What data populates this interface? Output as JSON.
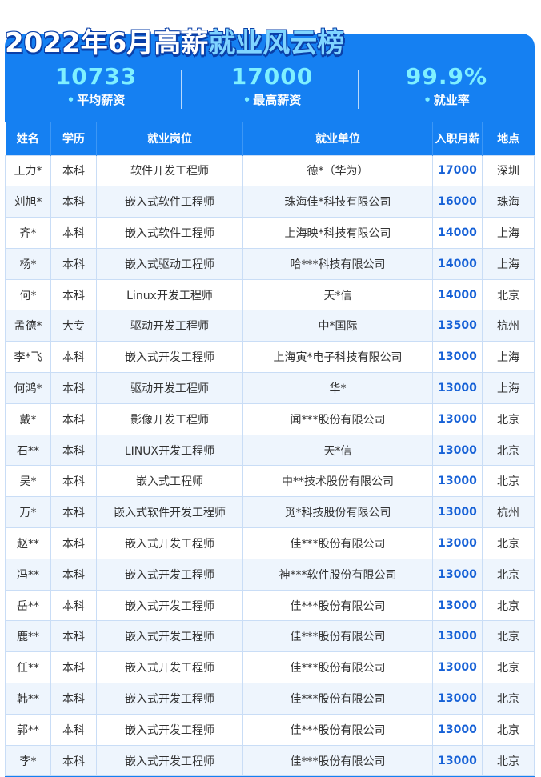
{
  "title": {
    "part1": "2022年6月高薪",
    "part2": "就业风云榜"
  },
  "stats": [
    {
      "value": "10733",
      "dot": "•",
      "label": "平均薪资"
    },
    {
      "value": "17000",
      "dot": "•",
      "label": "最高薪资"
    },
    {
      "value": "99.9%",
      "dot": "•",
      "label": "就业率"
    }
  ],
  "table": {
    "headers": [
      "姓名",
      "学历",
      "就业岗位",
      "就业单位",
      "入职月薪",
      "地点"
    ],
    "rows": [
      [
        "王力*",
        "本科",
        "软件开发工程师",
        "德*（华为）",
        "17000",
        "深圳"
      ],
      [
        "刘旭*",
        "本科",
        "嵌入式软件工程师",
        "珠海佳*科技有限公司",
        "16000",
        "珠海"
      ],
      [
        "齐*",
        "本科",
        "嵌入式软件工程师",
        "上海映*科技有限公司",
        "14000",
        "上海"
      ],
      [
        "杨*",
        "本科",
        "嵌入式驱动工程师",
        "哈***科技有限公司",
        "14000",
        "上海"
      ],
      [
        "何*",
        "本科",
        "Linux开发工程师",
        "天*信",
        "14000",
        "北京"
      ],
      [
        "孟德*",
        "大专",
        "驱动开发工程师",
        "中*国际",
        "13500",
        "杭州"
      ],
      [
        "李*飞",
        "本科",
        "嵌入式开发工程师",
        "上海寅*电子科技有限公司",
        "13000",
        "上海"
      ],
      [
        "何鸿*",
        "本科",
        "驱动开发工程师",
        "华*",
        "13000",
        "上海"
      ],
      [
        "戴*",
        "本科",
        "影像开发工程师",
        "闻***股份有限公司",
        "13000",
        "北京"
      ],
      [
        "石**",
        "本科",
        "LINUX开发工程师",
        "天*信",
        "13000",
        "北京"
      ],
      [
        "吴*",
        "本科",
        "嵌入式工程师",
        "中**技术股份有限公司",
        "13000",
        "北京"
      ],
      [
        "万*",
        "本科",
        "嵌入式软件开发工程师",
        "觅*科技股份有限公司",
        "13000",
        "杭州"
      ],
      [
        "赵**",
        "本科",
        "嵌入式开发工程师",
        "佳***股份有限公司",
        "13000",
        "北京"
      ],
      [
        "冯**",
        "本科",
        "嵌入式开发工程师",
        "神***软件股份有限公司",
        "13000",
        "北京"
      ],
      [
        "岳**",
        "本科",
        "嵌入式开发工程师",
        "佳***股份有限公司",
        "13000",
        "北京"
      ],
      [
        "鹿**",
        "本科",
        "嵌入式开发工程师",
        "佳***股份有限公司",
        "13000",
        "北京"
      ],
      [
        "任**",
        "本科",
        "嵌入式开发工程师",
        "佳***股份有限公司",
        "13000",
        "北京"
      ],
      [
        "韩**",
        "本科",
        "嵌入式开发工程师",
        "佳***股份有限公司",
        "13000",
        "北京"
      ],
      [
        "郭**",
        "本科",
        "嵌入式开发工程师",
        "佳***股份有限公司",
        "13000",
        "北京"
      ],
      [
        "李*",
        "本科",
        "嵌入式开发工程师",
        "佳***股份有限公司",
        "13000",
        "北京"
      ]
    ]
  },
  "colors": {
    "frame_blue": "#1580f2",
    "title_accent": "#7fd4ff",
    "stat_value": "#7ff0ff",
    "salary_text": "#1560d6",
    "row_alt": "#eef5fd"
  }
}
